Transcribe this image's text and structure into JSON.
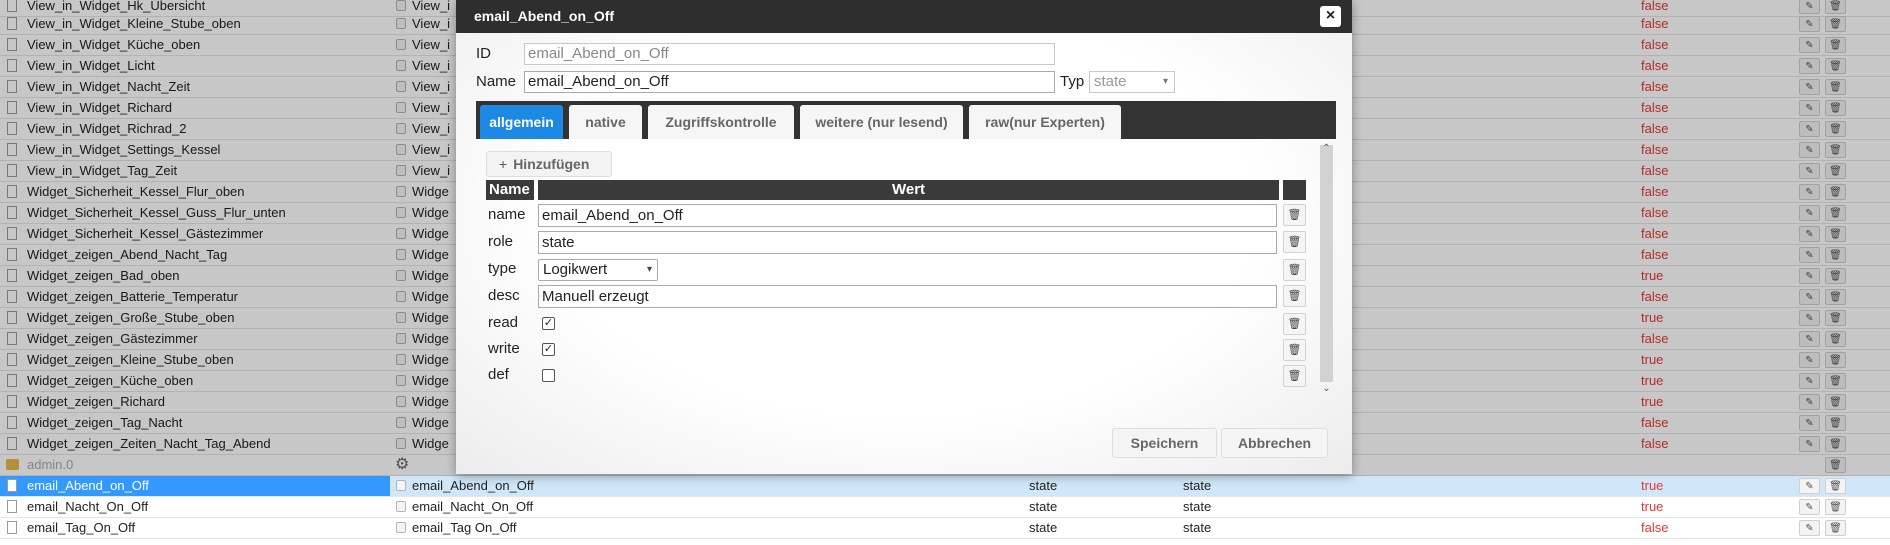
{
  "list": {
    "rows": [
      {
        "name": "View_in_Widget_Hk_Übersicht",
        "id": "View_i",
        "role": "",
        "type": "",
        "value": "false"
      },
      {
        "name": "View_in_Widget_Kleine_Stube_oben",
        "id": "View_i",
        "role": "",
        "type": "",
        "value": "false"
      },
      {
        "name": "View_in_Widget_Küche_oben",
        "id": "View_i",
        "role": "",
        "type": "",
        "value": "false"
      },
      {
        "name": "View_in_Widget_Licht",
        "id": "View_i",
        "role": "",
        "type": "",
        "value": "false"
      },
      {
        "name": "View_in_Widget_Nacht_Zeit",
        "id": "View_i",
        "role": "",
        "type": "",
        "value": "false"
      },
      {
        "name": "View_in_Widget_Richard",
        "id": "View_i",
        "role": "",
        "type": "",
        "value": "false"
      },
      {
        "name": "View_in_Widget_Richrad_2",
        "id": "View_i",
        "role": "",
        "type": "",
        "value": "false"
      },
      {
        "name": "View_in_Widget_Settings_Kessel",
        "id": "View_i",
        "role": "",
        "type": "",
        "value": "false"
      },
      {
        "name": "View_in_Widget_Tag_Zeit",
        "id": "View_i",
        "role": "",
        "type": "",
        "value": "false"
      },
      {
        "name": "Widget_Sicherheit_Kessel_Flur_oben",
        "id": "Widge",
        "role": "",
        "type": "",
        "value": "false"
      },
      {
        "name": "Widget_Sicherheit_Kessel_Guss_Flur_unten",
        "id": "Widge",
        "role": "",
        "type": "",
        "value": "false"
      },
      {
        "name": "Widget_Sicherheit_Kessel_Gästezimmer",
        "id": "Widge",
        "role": "",
        "type": "",
        "value": "false"
      },
      {
        "name": "Widget_zeigen_Abend_Nacht_Tag",
        "id": "Widge",
        "role": "",
        "type": "",
        "value": "false"
      },
      {
        "name": "Widget_zeigen_Bad_oben",
        "id": "Widge",
        "role": "",
        "type": "",
        "value": "true"
      },
      {
        "name": "Widget_zeigen_Batterie_Temperatur",
        "id": "Widge",
        "role": "",
        "type": "",
        "value": "false"
      },
      {
        "name": "Widget_zeigen_Große_Stube_oben",
        "id": "Widge",
        "role": "",
        "type": "",
        "value": "true"
      },
      {
        "name": "Widget_zeigen_Gästezimmer",
        "id": "Widge",
        "role": "",
        "type": "",
        "value": "false"
      },
      {
        "name": "Widget_zeigen_Kleine_Stube_oben",
        "id": "Widge",
        "role": "",
        "type": "",
        "value": "true"
      },
      {
        "name": "Widget_zeigen_Küche_oben",
        "id": "Widge",
        "role": "",
        "type": "",
        "value": "true"
      },
      {
        "name": "Widget_zeigen_Richard",
        "id": "Widge",
        "role": "",
        "type": "",
        "value": "true"
      },
      {
        "name": "Widget_zeigen_Tag_Nacht",
        "id": "Widge",
        "role": "",
        "type": "",
        "value": "false"
      },
      {
        "name": "Widget_zeigen_Zeiten_Nacht_Tag_Abend",
        "id": "Widge",
        "role": "",
        "type": "",
        "value": "false"
      },
      {
        "name": "admin.0",
        "id": "",
        "role": "",
        "type": "",
        "value": "",
        "folder": true
      },
      {
        "name": "email_Abend_on_Off",
        "id": "email_Abend_on_Off",
        "role": "state",
        "type": "state",
        "value": "true",
        "selected": true
      },
      {
        "name": "email_Nacht_On_Off",
        "id": "email_Nacht_On_Off",
        "role": "state",
        "type": "state",
        "value": "true"
      },
      {
        "name": "email_Tag_On_Off",
        "id": "email_Tag On_Off",
        "role": "state",
        "type": "state",
        "value": "false"
      }
    ]
  },
  "dialog": {
    "title": "email_Abend_on_Off",
    "close_glyph": "×",
    "id_label": "ID",
    "id_value": "email_Abend_on_Off",
    "name_label": "Name",
    "name_value": "email_Abend_on_Off",
    "typ_label": "Typ",
    "typ_value": "state",
    "tabs": [
      {
        "label": "allgemein",
        "active": true
      },
      {
        "label": "native"
      },
      {
        "label": "Zugriffskontrolle"
      },
      {
        "label": "weitere (nur lesend)"
      },
      {
        "label": "raw(nur Experten)"
      }
    ],
    "add_label": "Hinzufügen",
    "table_headers": {
      "name": "Name",
      "value": "Wert"
    },
    "props": [
      {
        "name": "name",
        "kind": "text",
        "value": "email_Abend_on_Off"
      },
      {
        "name": "role",
        "kind": "text",
        "value": "state"
      },
      {
        "name": "type",
        "kind": "select",
        "value": "Logikwert"
      },
      {
        "name": "desc",
        "kind": "text",
        "value": "Manuell erzeugt"
      },
      {
        "name": "read",
        "kind": "checkbox",
        "checked": true
      },
      {
        "name": "write",
        "kind": "checkbox",
        "checked": true
      },
      {
        "name": "def",
        "kind": "checkbox",
        "checked": false
      }
    ],
    "save_label": "Speichern",
    "cancel_label": "Abbrechen"
  },
  "icons": {
    "check": "✓",
    "trash": "🗑",
    "pencil": "✎",
    "gear": "⚙",
    "plus": "+",
    "chevron": "▾",
    "up": "⌃",
    "down": "⌄"
  },
  "colors": {
    "accent": "#1e88e5",
    "titlebar": "#2e2e2e",
    "value_red": "#e53935",
    "selection": "#3399ff"
  }
}
